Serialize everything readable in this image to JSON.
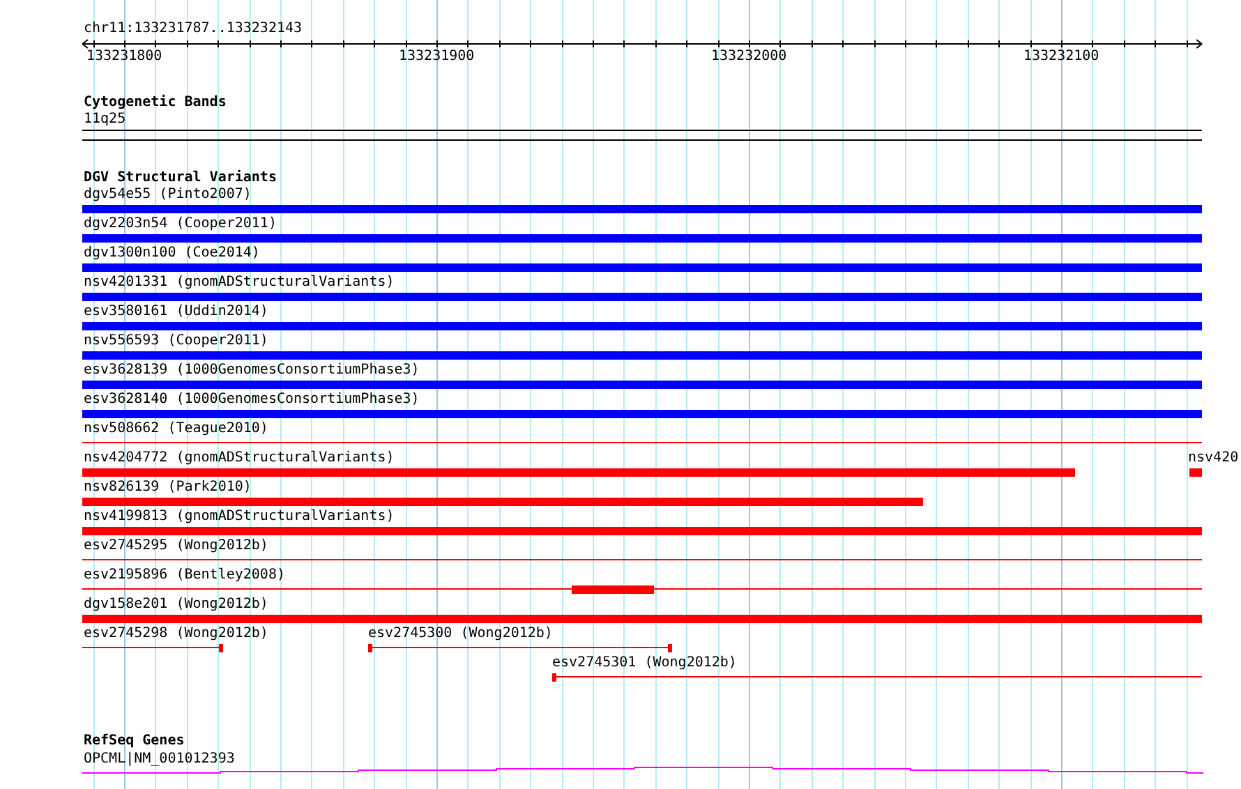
{
  "location": "chr11:133231787..133232143",
  "ruler": {
    "ticks": [
      "133231800",
      "133231900",
      "133232000",
      "133232100"
    ]
  },
  "tracks": [
    {
      "title": "Cytogenetic Bands",
      "features": [
        {
          "label": "11q25"
        }
      ]
    },
    {
      "title": "DGV Structural Variants",
      "features": [
        {
          "label": "dgv54e55 (Pinto2007)",
          "color": "#0000ff"
        },
        {
          "label": "dgv2203n54 (Cooper2011)",
          "color": "#0000ff"
        },
        {
          "label": "dgv1300n100 (Coe2014)",
          "color": "#0000ff"
        },
        {
          "label": "nsv4201331 (gnomADStructuralVariants)",
          "color": "#0000ff"
        },
        {
          "label": "esv3580161 (Uddin2014)",
          "color": "#0000ff"
        },
        {
          "label": "nsv556593 (Cooper2011)",
          "color": "#0000ff"
        },
        {
          "label": "esv3628139 (1000GenomesConsortiumPhase3)",
          "color": "#0000ff"
        },
        {
          "label": "esv3628140 (1000GenomesConsortiumPhase3)",
          "color": "#0000ff"
        },
        {
          "label": "nsv508662 (Teague2010)",
          "color": "#ff0000"
        },
        {
          "label": "nsv4204772 (gnomADStructuralVariants)",
          "color": "#ff0000"
        },
        {
          "label": "nsv420",
          "color": "#ff0000"
        },
        {
          "label": "nsv826139 (Park2010)",
          "color": "#ff0000"
        },
        {
          "label": "nsv4199813 (gnomADStructuralVariants)",
          "color": "#ff0000"
        },
        {
          "label": "esv2745295 (Wong2012b)",
          "color": "#ff0000"
        },
        {
          "label": "esv2195896 (Bentley2008)",
          "color": "#ff0000"
        },
        {
          "label": "dgv158e201 (Wong2012b)",
          "color": "#ff0000"
        },
        {
          "label": "esv2745298 (Wong2012b)",
          "color": "#ff0000"
        },
        {
          "label": "esv2745300 (Wong2012b)",
          "color": "#ff0000"
        },
        {
          "label": "esv2745301 (Wong2012b)",
          "color": "#ff0000"
        }
      ]
    },
    {
      "title": "RefSeq Genes",
      "features": [
        {
          "label": "OPCML|NM_001012393"
        }
      ]
    }
  ]
}
